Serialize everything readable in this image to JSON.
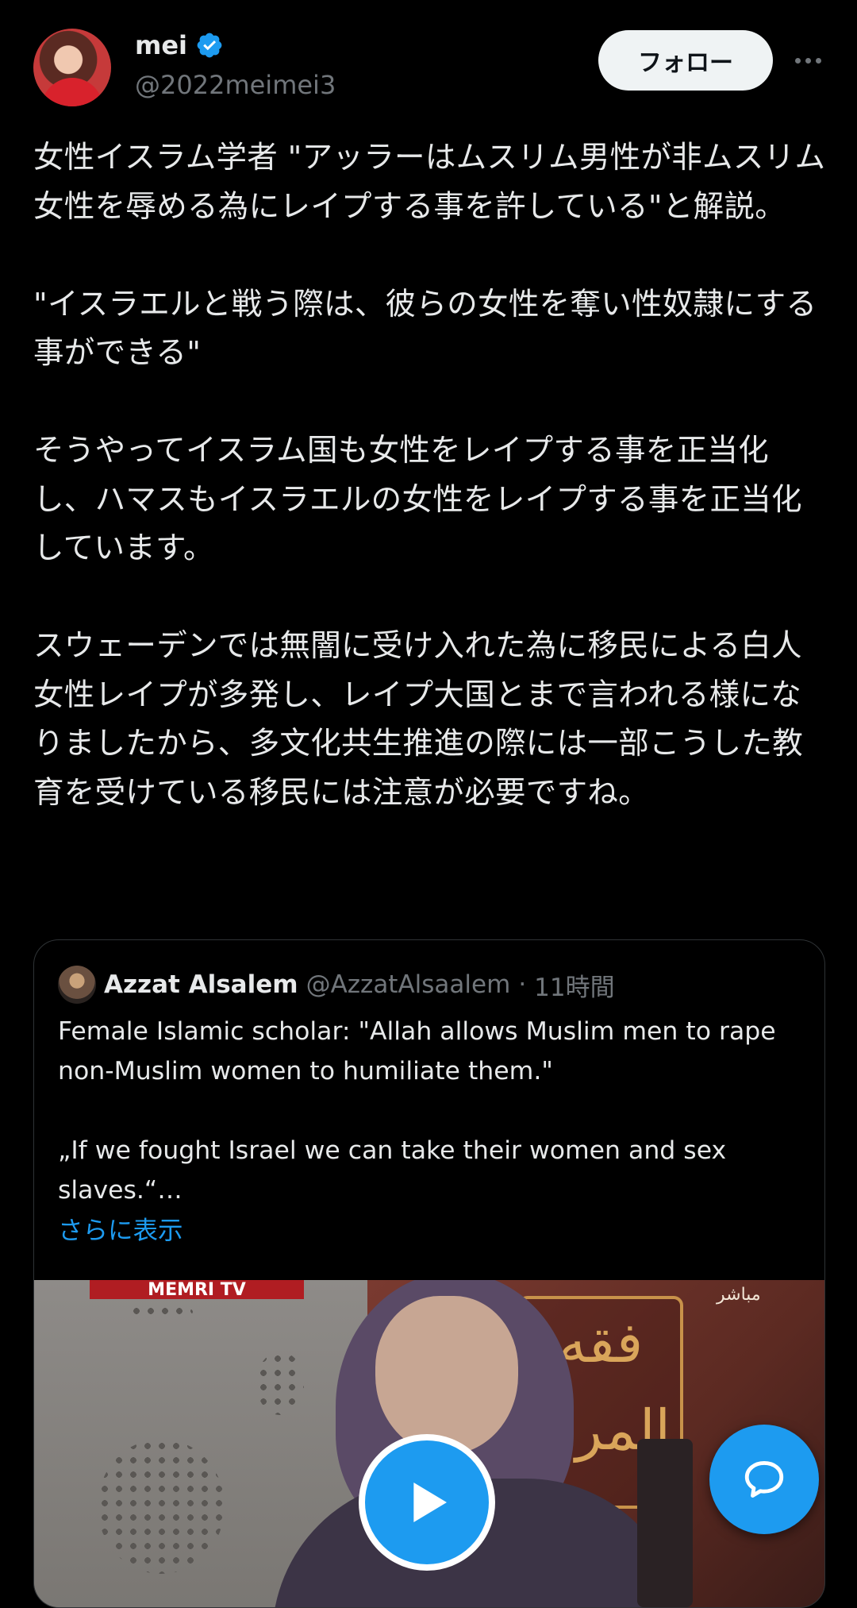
{
  "author": {
    "name": "mei",
    "handle": "@2022meimei3",
    "verified": true,
    "verified_color": "#1d9bf0"
  },
  "actions": {
    "follow_label": "フォロー",
    "more_icon": "more-horizontal-icon"
  },
  "post": {
    "text": "女性イスラム学者 \"アッラーはムスリム男性が非ムスリム女性を辱める為にレイプする事を許している\"と解説。\n\n\"イスラエルと戦う際は、彼らの女性を奪い性奴隷にする事ができる\"\n\nそうやってイスラム国も女性をレイプする事を正当化し、ハマスもイスラエルの女性をレイプする事を正当化しています。\n\nスウェーデンでは無闇に受け入れた為に移民による白人女性レイプが多発し、レイプ大国とまで言われる様になりましたから、多文化共生推進の際には一部こうした教育を受けている移民には注意が必要ですね。"
  },
  "quote": {
    "name": "Azzat Alsalem",
    "handle": "@AzzatAlsaalem",
    "separator": "·",
    "time": "11時間",
    "text": "Female Islamic scholar: \"Allah allows Muslim men to rape non-Muslim women to humiliate them.\"\n\n„If we fought Israel we can take their women and sex slaves.“…",
    "show_more": "さらに表示",
    "media": {
      "type": "video",
      "logo_text": "MEMRI TV",
      "overlay_arabic": "فقه المرأة",
      "live_text": "مباشر"
    }
  },
  "controls": {
    "play_icon": "play-icon",
    "compose_icon": "chat-bubble-icon",
    "accent": "#1d9bf0"
  }
}
